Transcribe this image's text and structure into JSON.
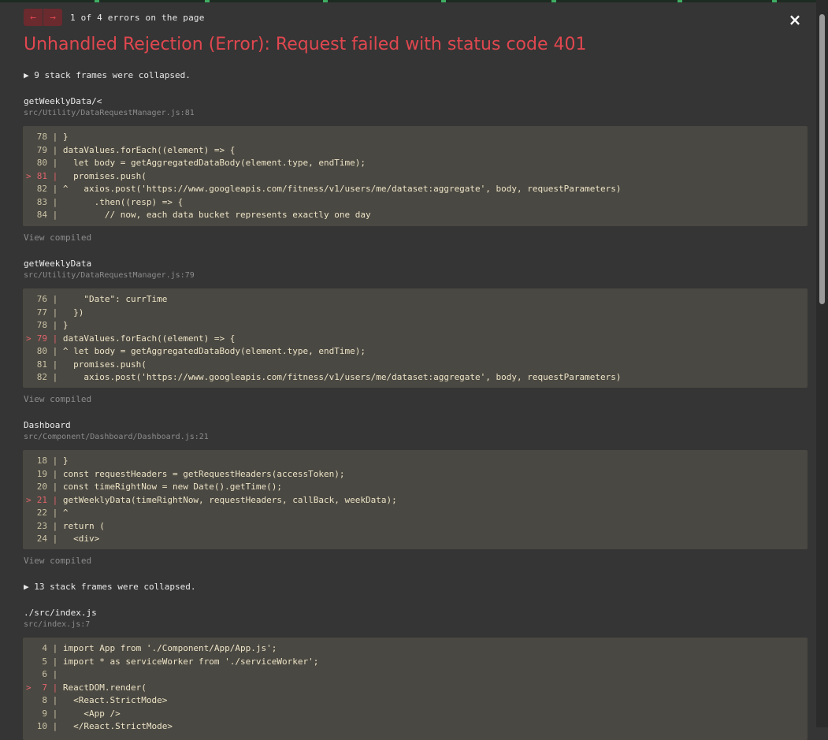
{
  "nav": {
    "prev_icon": "←",
    "next_icon": "→",
    "counter": "1 of 4 errors on the page",
    "close_icon": "×"
  },
  "error_title": "Unhandled Rejection (Error): Request failed with status code 401",
  "collapsed_1": "▶ 9 stack frames were collapsed.",
  "collapsed_2": "▶ 13 stack frames were collapsed.",
  "view_compiled": "View compiled",
  "frames": [
    {
      "function": "getWeeklyData/<",
      "location": "src/Utility/DataRequestManager.js:81",
      "lines": [
        {
          "marker": "",
          "num": "78",
          "code": " }"
        },
        {
          "marker": "",
          "num": "79",
          "code": " dataValues.forEach((element) => {"
        },
        {
          "marker": "",
          "num": "80",
          "code": "   let body = getAggregatedDataBody(element.type, endTime);"
        },
        {
          "marker": ">",
          "num": "81",
          "code": "   promises.push("
        },
        {
          "marker": "",
          "num": "82",
          "code": " ^   axios.post('https://www.googleapis.com/fitness/v1/users/me/dataset:aggregate', body, requestParameters)"
        },
        {
          "marker": "",
          "num": "83",
          "code": "       .then((resp) => {"
        },
        {
          "marker": "",
          "num": "84",
          "code": "         // now, each data bucket represents exactly one day"
        }
      ]
    },
    {
      "function": "getWeeklyData",
      "location": "src/Utility/DataRequestManager.js:79",
      "lines": [
        {
          "marker": "",
          "num": "76",
          "code": "     \"Date\": currTime"
        },
        {
          "marker": "",
          "num": "77",
          "code": "   })"
        },
        {
          "marker": "",
          "num": "78",
          "code": " }"
        },
        {
          "marker": ">",
          "num": "79",
          "code": " dataValues.forEach((element) => {"
        },
        {
          "marker": "",
          "num": "80",
          "code": " ^ let body = getAggregatedDataBody(element.type, endTime);"
        },
        {
          "marker": "",
          "num": "81",
          "code": "   promises.push("
        },
        {
          "marker": "",
          "num": "82",
          "code": "     axios.post('https://www.googleapis.com/fitness/v1/users/me/dataset:aggregate', body, requestParameters)"
        }
      ]
    },
    {
      "function": "Dashboard",
      "location": "src/Component/Dashboard/Dashboard.js:21",
      "lines": [
        {
          "marker": "",
          "num": "18",
          "code": " }"
        },
        {
          "marker": "",
          "num": "19",
          "code": " const requestHeaders = getRequestHeaders(accessToken);"
        },
        {
          "marker": "",
          "num": "20",
          "code": " const timeRightNow = new Date().getTime();"
        },
        {
          "marker": ">",
          "num": "21",
          "code": " getWeeklyData(timeRightNow, requestHeaders, callBack, weekData);"
        },
        {
          "marker": "",
          "num": "22",
          "code": " ^"
        },
        {
          "marker": "",
          "num": "23",
          "code": " return ("
        },
        {
          "marker": "",
          "num": "24",
          "code": "   <div>"
        }
      ]
    },
    {
      "function": "./src/index.js",
      "location": "src/index.js:7",
      "lines": [
        {
          "marker": "",
          "num": "4",
          "code": " import App from './Component/App/App.js';"
        },
        {
          "marker": "",
          "num": "5",
          "code": " import * as serviceWorker from './serviceWorker';"
        },
        {
          "marker": "",
          "num": "6",
          "code": ""
        },
        {
          "marker": ">",
          "num": "7",
          "code": " ReactDOM.render("
        },
        {
          "marker": "",
          "num": "8",
          "code": "   <React.StrictMode>"
        },
        {
          "marker": "",
          "num": "9",
          "code": "     <App />"
        },
        {
          "marker": "",
          "num": "10",
          "code": "   </React.StrictMode>"
        }
      ]
    }
  ]
}
